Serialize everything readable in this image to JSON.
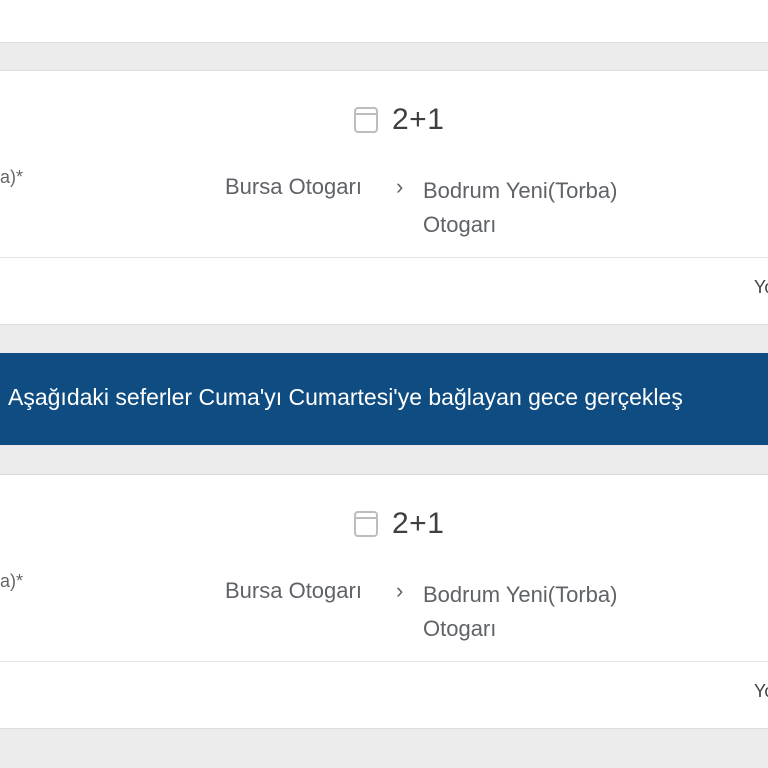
{
  "trips": [
    {
      "seat_layout": "2+1",
      "left_fragment": "a)*",
      "origin": "Bursa Otogarı",
      "destination": "Bodrum Yeni(Torba) Otogarı",
      "right_fragment": "Yo"
    },
    {
      "seat_layout": "2+1",
      "left_fragment": "a)*",
      "origin": "Bursa Otogarı",
      "destination": "Bodrum Yeni(Torba) Otogarı",
      "right_fragment": "Yo"
    }
  ],
  "notice": {
    "text": "Aşağıdaki seferler Cuma'yı Cumartesi'ye bağlayan gece gerçekleş"
  },
  "icons": {
    "seat": "seat-icon",
    "route_arrow": "chevron-right-icon"
  },
  "colors": {
    "notice_bg": "#0f4c81",
    "page_bg": "#ececec",
    "card_bg": "#ffffff",
    "text_muted": "#5f6368"
  }
}
